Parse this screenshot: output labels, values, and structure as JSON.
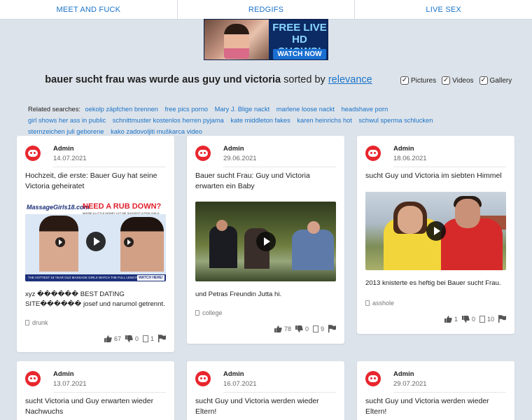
{
  "nav": [
    {
      "label": "MEET AND FUCK"
    },
    {
      "label": "REDGIFS"
    },
    {
      "label": "LIVE SEX"
    }
  ],
  "banner": {
    "headline": "FREE LIVE HD SHOWS!",
    "cta": "WATCH NOW"
  },
  "heading": {
    "query": "bauer sucht frau was wurde aus guy und victoria",
    "sorted_by": "sorted by",
    "sort": "relevance"
  },
  "filters": [
    {
      "label": "Pictures",
      "checked": true
    },
    {
      "label": "Videos",
      "checked": true
    },
    {
      "label": "Gallery",
      "checked": true
    }
  ],
  "related": {
    "label": "Related searches:",
    "links": [
      "oekolp zäpfchen brennen",
      "free pics porno",
      "Mary J. Blige nackt",
      "marlene loose nackt",
      "headshave porn",
      "girl shows her ass in public",
      "schnittmuster kostenlos herren pyjama",
      "kate middleton fakes",
      "karen heinrichs hot",
      "schwul sperma schlucken",
      "sternzeichen juli geborene",
      "kako zadovoljiti muškarca video"
    ]
  },
  "cards": [
    {
      "author": "Admin",
      "date": "14.07.2021",
      "title": "Hochzeit, die erste: Bauer Guy hat seine Victoria geheiratet",
      "ad": {
        "logo": "MassageGirls18.com",
        "headline": "NEED A RUB DOWN?",
        "sub": "MAYBE A LITTLE MONEY LET ME SUGGEST A FEW CHILD",
        "bar": "THE HOTTEST 18 YEAR OLD MASSAGE GIRLS WATCH THE FULL LENGTH VIDEO",
        "watch": "WATCH HERE!"
      },
      "desc": "xyz ������ BEST DATING SITE������ josef und narumol getrennt.",
      "tag": "drunk",
      "likes": "67",
      "dislikes": "0",
      "comments": "1"
    },
    {
      "author": "Admin",
      "date": "29.06.2021",
      "title": "Bauer sucht Frau: Guy und Victoria erwarten ein Baby",
      "desc": "und Petras Freundin Jutta hi.",
      "tag": "college",
      "likes": "78",
      "dislikes": "0",
      "comments": "9"
    },
    {
      "author": "Admin",
      "date": "18.06.2021",
      "title": "sucht Guy und Victoria im siebten Himmel",
      "desc": "2013 knisterte es heftig bei Bauer sucht Frau.",
      "tag": "asshole",
      "likes": "1",
      "dislikes": "0",
      "comments": "10"
    },
    {
      "author": "Admin",
      "date": "13.07.2021",
      "title": "sucht Victoria und Guy erwarten wieder Nachwuchs"
    },
    {
      "author": "Admin",
      "date": "16.07.2021",
      "title": "sucht Guy und Victoria werden wieder Eltern!"
    },
    {
      "author": "Admin",
      "date": "29.07.2021",
      "title": "sucht Guy und Victoria werden wieder Eltern!"
    }
  ],
  "colors": {
    "link": "#1a73c9",
    "background": "#dde3ea",
    "avatar": "#e8262d"
  },
  "icons": [
    "like-icon",
    "dislike-icon",
    "comment-icon",
    "flag-icon",
    "tag-icon",
    "play-icon",
    "checkbox-icon"
  ]
}
